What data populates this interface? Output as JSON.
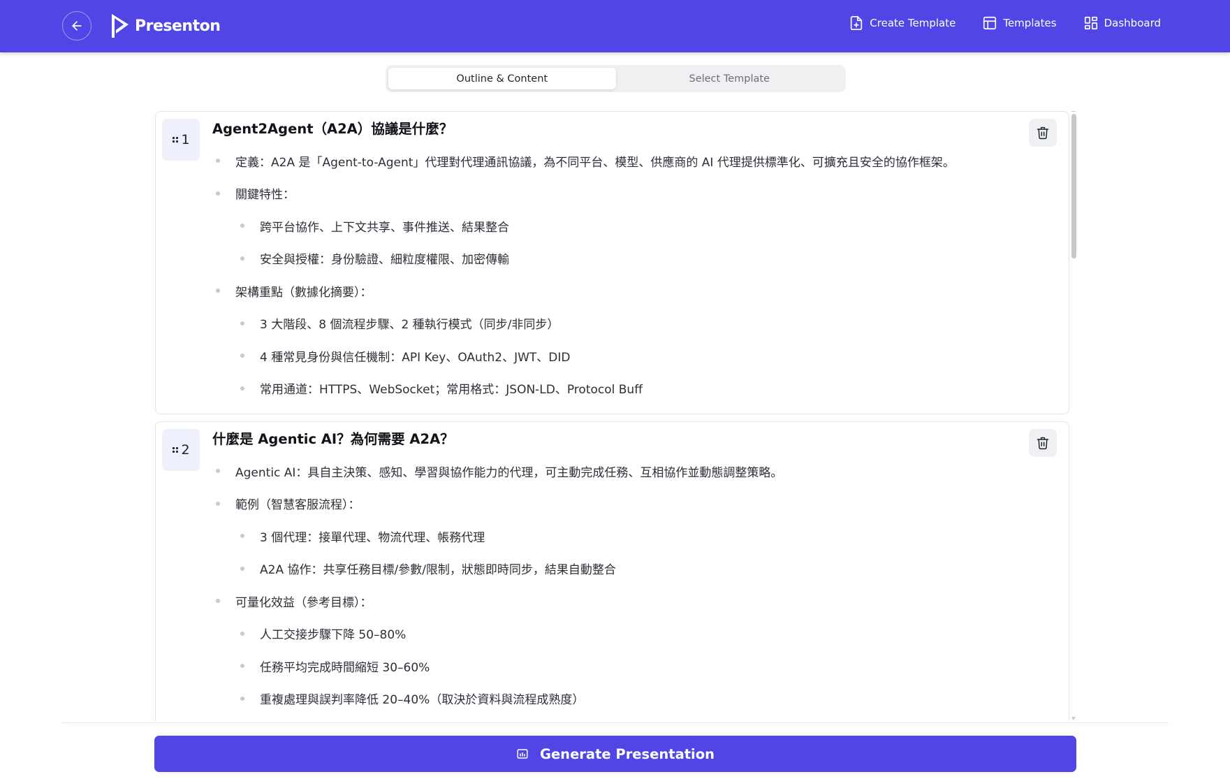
{
  "header": {
    "brand": "Presenton",
    "nav": [
      {
        "label": "Create Template",
        "icon": "file-plus-icon"
      },
      {
        "label": "Templates",
        "icon": "layout-icon"
      },
      {
        "label": "Dashboard",
        "icon": "grid-icon"
      }
    ]
  },
  "tabs": [
    {
      "label": "Outline & Content",
      "active": true
    },
    {
      "label": "Select Template",
      "active": false
    }
  ],
  "slides": [
    {
      "number": "1",
      "title": "Agent2Agent（A2A）協議是什麼？",
      "bullets": [
        {
          "level": 1,
          "text": "定義：A2A 是「Agent-to-Agent」代理對代理通訊協議，為不同平台、模型、供應商的 AI 代理提供標準化、可擴充且安全的協作框架。"
        },
        {
          "level": 1,
          "text": "關鍵特性："
        },
        {
          "level": 2,
          "text": "跨平台協作、上下文共享、事件推送、結果整合"
        },
        {
          "level": 2,
          "text": "安全與授權：身份驗證、細粒度權限、加密傳輸"
        },
        {
          "level": 1,
          "text": "架構重點（數據化摘要）："
        },
        {
          "level": 2,
          "text": "3 大階段、8 個流程步驟、2 種執行模式（同步/非同步）"
        },
        {
          "level": 2,
          "text": "4 種常見身份與信任機制：API Key、OAuth2、JWT、DID"
        },
        {
          "level": 2,
          "text": "常用通道：HTTPS、WebSocket；常用格式：JSON-LD、Protocol Buff"
        }
      ]
    },
    {
      "number": "2",
      "title": "什麼是 Agentic AI？為何需要 A2A？",
      "bullets": [
        {
          "level": 1,
          "text": "Agentic AI：具自主決策、感知、學習與協作能力的代理，可主動完成任務、互相協作並動態調整策略。"
        },
        {
          "level": 1,
          "text": "範例（智慧客服流程）："
        },
        {
          "level": 2,
          "text": "3 個代理：接單代理、物流代理、帳務代理"
        },
        {
          "level": 2,
          "text": "A2A 協作：共享任務目標/參數/限制，狀態即時同步，結果自動整合"
        },
        {
          "level": 1,
          "text": "可量化效益（參考目標）："
        },
        {
          "level": 2,
          "text": "人工交接步驟下降 50–80%"
        },
        {
          "level": 2,
          "text": "任務平均完成時間縮短 30–60%"
        },
        {
          "level": 2,
          "text": "重複處理與誤判率降低 20–40%（取決於資料與流程成熟度）"
        }
      ]
    }
  ],
  "footer": {
    "generate_label": "Generate Presentation"
  },
  "colors": {
    "brand": "#5146e5",
    "card_border": "#e3e4e8",
    "number_badge": "#eef1fb"
  }
}
